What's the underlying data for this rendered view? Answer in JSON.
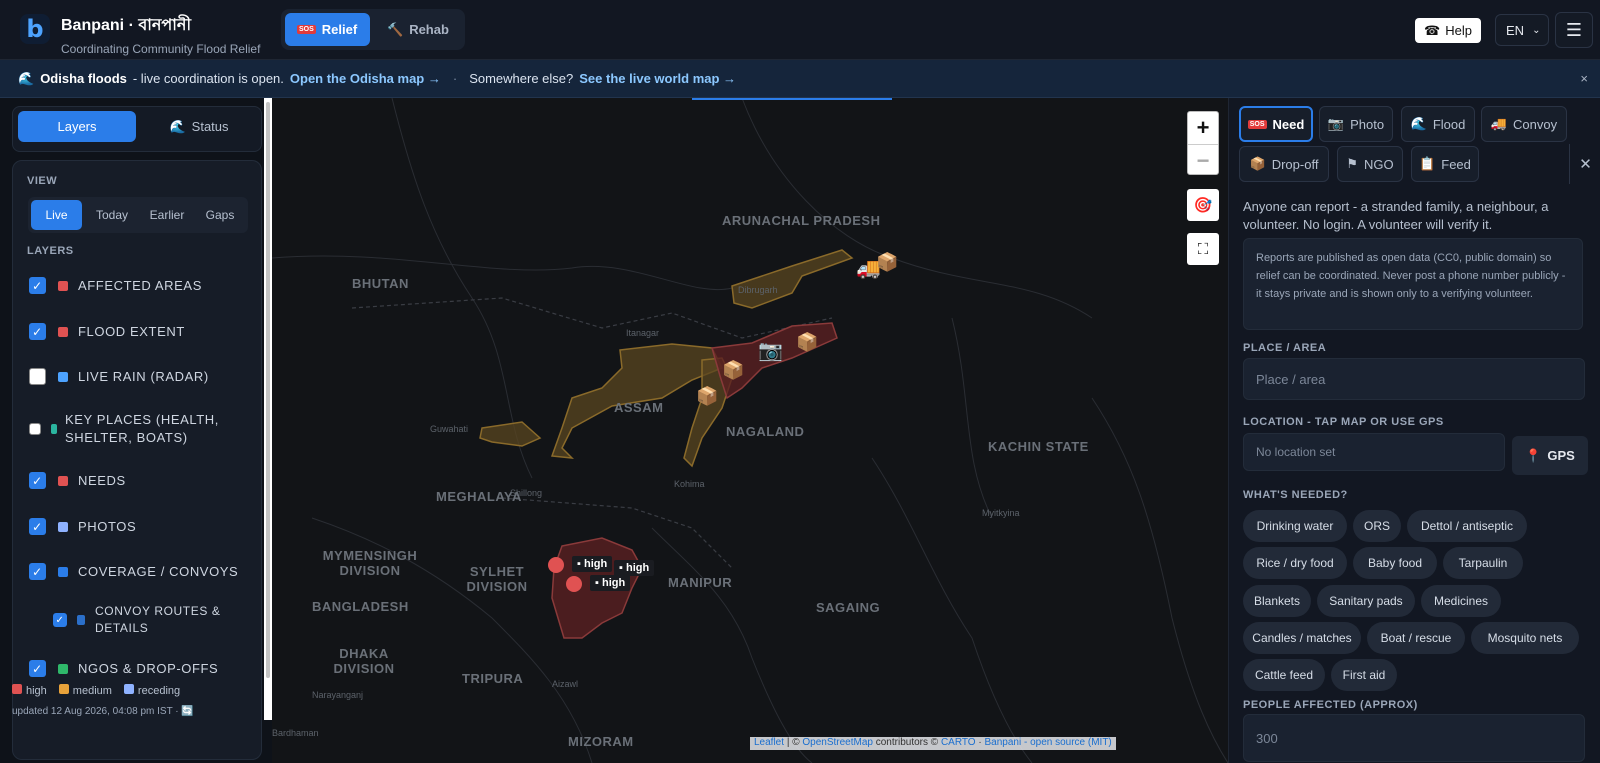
{
  "app": {
    "name": "Banpani · বানপানী",
    "tagline": "Coordinating Community Flood Relief",
    "logo_letter": "b",
    "modes": [
      {
        "label": "Relief",
        "icon": "sos-icon",
        "active": true
      },
      {
        "label": "Rehab",
        "icon": "hammer-icon",
        "active": false
      }
    ],
    "help_label": "Help",
    "language": "EN",
    "accent": "#2b7de9"
  },
  "banner": {
    "lead": "Odisha floods",
    "text": "- live coordination is open.",
    "link1": "Open the Odisha map →",
    "sep": "·",
    "text2": "Somewhere else?",
    "link2": "See the live world map →",
    "close": "×"
  },
  "sidebar": {
    "tabs": [
      {
        "label": "Layers",
        "active": true
      },
      {
        "label": "Status",
        "active": false
      }
    ],
    "view_heading": "VIEW",
    "view_tabs": [
      {
        "label": "Live",
        "active": true
      },
      {
        "label": "Today",
        "active": false
      },
      {
        "label": "Earlier",
        "active": false
      },
      {
        "label": "Gaps",
        "active": false
      }
    ],
    "layers_heading": "LAYERS",
    "layers": [
      {
        "label": "AFFECTED AREAS",
        "checked": true,
        "color": "#e05252"
      },
      {
        "label": "FLOOD EXTENT",
        "checked": true,
        "color": "#e05252"
      },
      {
        "label": "LIVE RAIN (RADAR)",
        "checked": false,
        "color": "#4da3ff"
      },
      {
        "label": "KEY PLACES (HEALTH, SHELTER, BOATS)",
        "checked": false,
        "color": "#2bb5a0"
      },
      {
        "label": "NEEDS",
        "checked": true,
        "color": "#e05252"
      },
      {
        "label": "PHOTOS",
        "checked": true,
        "color": "#8fb2ff"
      },
      {
        "label": "COVERAGE / CONVOYS",
        "checked": true,
        "color": "#2b7de9"
      },
      {
        "label": "CONVOY ROUTES & DETAILS",
        "checked": true,
        "color": "#2b6fc9"
      },
      {
        "label": "NGOS & DROP-OFFS",
        "checked": true,
        "color": "#2fb86a"
      }
    ],
    "legend": [
      {
        "label": "high",
        "color": "#e05252"
      },
      {
        "label": "medium",
        "color": "#e8a23a"
      },
      {
        "label": "receding",
        "color": "#8fb2ff"
      }
    ],
    "updated": "updated 12 Aug 2026, 04:08 pm IST ·"
  },
  "map": {
    "labels": [
      {
        "text": "ARUNACHAL PRADESH"
      },
      {
        "text": "BHUTAN"
      },
      {
        "text": "ASSAM"
      },
      {
        "text": "NAGALAND"
      },
      {
        "text": "KACHIN STATE"
      },
      {
        "text": "MEGHALAYA"
      },
      {
        "text": "MYMENSINGH DIVISION"
      },
      {
        "text": "SYLHET DIVISION"
      },
      {
        "text": "BANGLADESH"
      },
      {
        "text": "MANIPUR"
      },
      {
        "text": "SAGAING"
      },
      {
        "text": "DHAKA DIVISION"
      },
      {
        "text": "TRIPURA"
      },
      {
        "text": "MIZORAM"
      }
    ],
    "small_labels": [
      "Dibrugarh",
      "Itanagar",
      "Guwahati",
      "Shillong",
      "Kohima",
      "Myitkyina",
      "Aizawl",
      "Narayanganj",
      "Bardhaman"
    ],
    "high_tags": [
      "high",
      "high",
      "high"
    ],
    "zoom_in": "+",
    "zoom_out": "−",
    "attribution": {
      "leaflet": "Leaflet",
      "osm": "OpenStreetMap",
      "carto": "CARTO",
      "banpani": "Banpani - open source (MIT)",
      "contributors": "contributors ©",
      "sep": "|"
    }
  },
  "report": {
    "tabs": [
      {
        "label": "Need",
        "icon": "sos-icon",
        "active": true
      },
      {
        "label": "Photo",
        "icon": "camera-icon",
        "active": false
      },
      {
        "label": "Flood",
        "icon": "wave-icon",
        "active": false
      },
      {
        "label": "Convoy",
        "icon": "truck-icon",
        "active": false
      },
      {
        "label": "Drop-off",
        "icon": "package-icon",
        "active": false
      },
      {
        "label": "NGO",
        "icon": "flag-icon",
        "active": false
      },
      {
        "label": "Feed",
        "icon": "clipboard-icon",
        "active": false
      }
    ],
    "intro": "Anyone can report - a stranded family, a neighbour, a volunteer. No login. A volunteer will verify it.",
    "notice": "Reports are published as open data (CC0, public domain) so relief can be coordinated. Never post a phone number publicly - it stays private and is shown only to a verifying volunteer.",
    "place_label": "PLACE / AREA",
    "place_placeholder": "Place / area",
    "location_label": "LOCATION - TAP MAP OR USE GPS",
    "location_value": "No location set",
    "gps_label": "GPS",
    "needs_label": "WHAT'S NEEDED?",
    "needs": [
      "Drinking water",
      "ORS",
      "Dettol / antiseptic",
      "Rice / dry food",
      "Baby food",
      "Tarpaulin",
      "Blankets",
      "Sanitary pads",
      "Medicines",
      "Candles / matches",
      "Boat / rescue",
      "Mosquito nets",
      "Cattle feed",
      "First aid"
    ],
    "people_label": "PEOPLE AFFECTED (APPROX)",
    "people_placeholder": "300"
  }
}
